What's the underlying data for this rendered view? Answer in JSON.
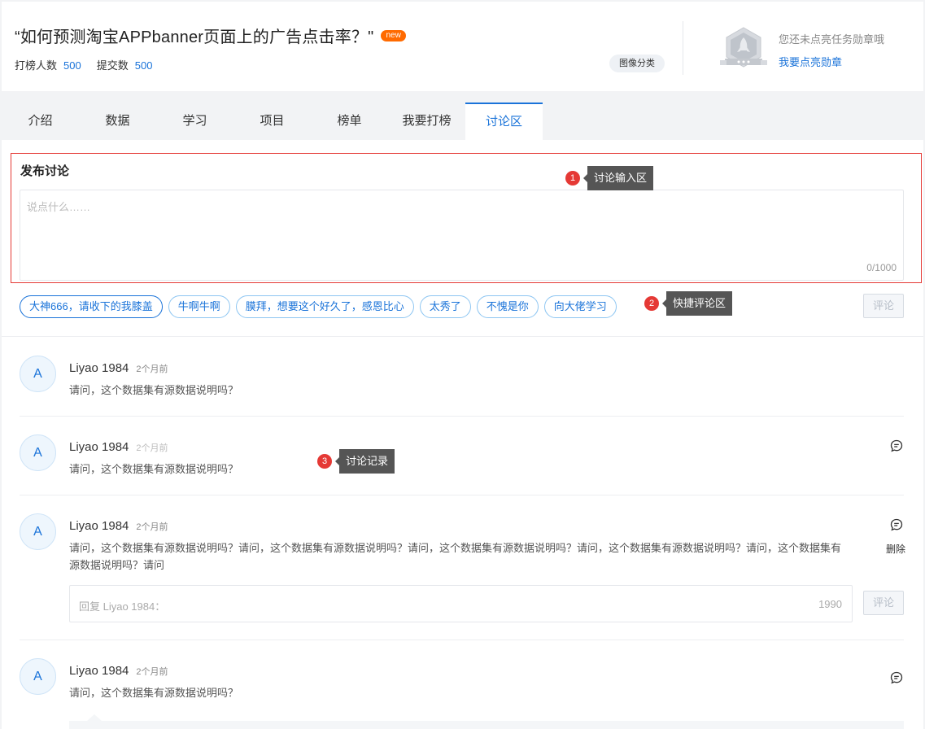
{
  "header": {
    "title": "“如何预测淘宝APPbanner页面上的广告点击率？\"",
    "badge": "new",
    "stats": [
      {
        "label": "打榜人数",
        "value": "500"
      },
      {
        "label": "提交数",
        "value": "500"
      }
    ],
    "category_tag": "图像分类",
    "medal_hint": "您还未点亮任务勋章哦",
    "medal_link": "我要点亮勋章"
  },
  "tabs": [
    {
      "label": "介绍",
      "active": false
    },
    {
      "label": "数据",
      "active": false
    },
    {
      "label": "学习",
      "active": false
    },
    {
      "label": "项目",
      "active": false
    },
    {
      "label": "榜单",
      "active": false
    },
    {
      "label": "我要打榜",
      "active": false
    },
    {
      "label": "讨论区",
      "active": true
    }
  ],
  "compose": {
    "title": "发布讨论",
    "placeholder": "说点什么……",
    "counter": "0/1000"
  },
  "annotations": [
    {
      "num": "1",
      "text": "讨论输入区"
    },
    {
      "num": "2",
      "text": "快捷评论区"
    },
    {
      "num": "3",
      "text": "讨论记录"
    }
  ],
  "quick_comments": [
    "大神666，请收下的我膝盖",
    "牛啊牛啊",
    "膜拜，想要这个好久了，感恩比心",
    "太秀了",
    "不愧是你",
    "向大佬学习"
  ],
  "submit_label": "评论",
  "comments": [
    {
      "avatar": "A",
      "user": "Liyao 1984",
      "time": "2个月前",
      "body": "请问，这个数据集有源数据说明吗？"
    },
    {
      "avatar": "A",
      "user": "Liyao 1984",
      "time": "2个月前",
      "body": "请问，这个数据集有源数据说明吗？"
    },
    {
      "avatar": "A",
      "user": "Liyao 1984",
      "time": "2个月前",
      "body": "请问，这个数据集有源数据说明吗？请问，这个数据集有源数据说明吗？请问，这个数据集有源数据说明吗？请问，这个数据集有源数据说明吗？请问，这个数据集有源数据说明吗？请问",
      "delete_label": "删除"
    },
    {
      "avatar": "A",
      "user": "Liyao 1984",
      "time": "2个月前",
      "body": "请问，这个数据集有源数据说明吗？"
    }
  ],
  "reply": {
    "placeholder": "回复 Liyao 1984：",
    "counter": "1990",
    "submit_label": "评论"
  },
  "colors": {
    "accent": "#1a73d9",
    "badge": "#ff6a00",
    "annotation": "#e53935"
  }
}
